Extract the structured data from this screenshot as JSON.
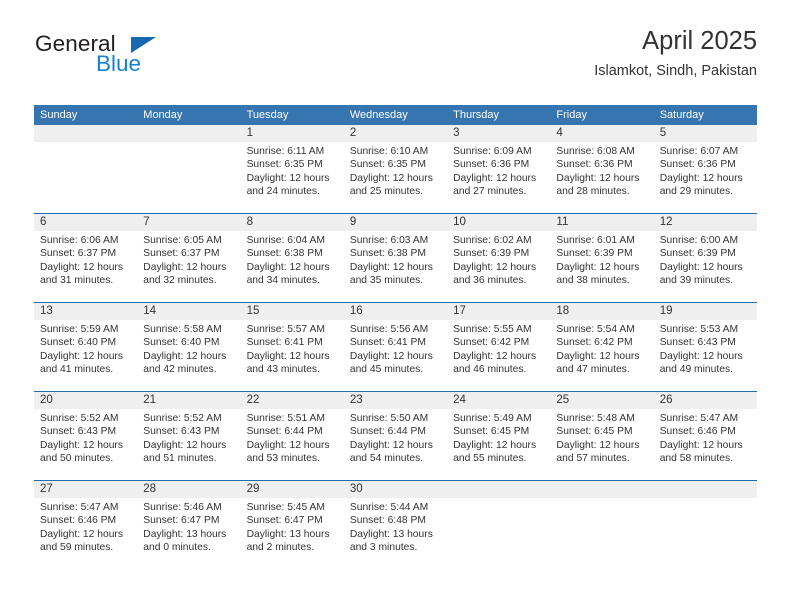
{
  "branding": {
    "logo_text_1": "General",
    "logo_text_2": "Blue",
    "logo_triangle_color": "#1669b0",
    "logo_blue_color": "#1682d4"
  },
  "header": {
    "title": "April 2025",
    "subtitle": "Islamkot, Sindh, Pakistan"
  },
  "colors": {
    "header_row_background": "#3675b0",
    "header_row_text": "#ffffff",
    "week_separator": "#1f6cb0",
    "daynum_band": "#efefef",
    "body_text": "#333333"
  },
  "weekday_headers": [
    "Sunday",
    "Monday",
    "Tuesday",
    "Wednesday",
    "Thursday",
    "Friday",
    "Saturday"
  ],
  "weeks": [
    [
      {
        "day": "",
        "sunrise": "",
        "sunset": "",
        "daylight": "",
        "empty": true
      },
      {
        "day": "",
        "sunrise": "",
        "sunset": "",
        "daylight": "",
        "empty": true
      },
      {
        "day": "1",
        "sunrise": "Sunrise: 6:11 AM",
        "sunset": "Sunset: 6:35 PM",
        "daylight": "Daylight: 12 hours and 24 minutes."
      },
      {
        "day": "2",
        "sunrise": "Sunrise: 6:10 AM",
        "sunset": "Sunset: 6:35 PM",
        "daylight": "Daylight: 12 hours and 25 minutes."
      },
      {
        "day": "3",
        "sunrise": "Sunrise: 6:09 AM",
        "sunset": "Sunset: 6:36 PM",
        "daylight": "Daylight: 12 hours and 27 minutes."
      },
      {
        "day": "4",
        "sunrise": "Sunrise: 6:08 AM",
        "sunset": "Sunset: 6:36 PM",
        "daylight": "Daylight: 12 hours and 28 minutes."
      },
      {
        "day": "5",
        "sunrise": "Sunrise: 6:07 AM",
        "sunset": "Sunset: 6:36 PM",
        "daylight": "Daylight: 12 hours and 29 minutes."
      }
    ],
    [
      {
        "day": "6",
        "sunrise": "Sunrise: 6:06 AM",
        "sunset": "Sunset: 6:37 PM",
        "daylight": "Daylight: 12 hours and 31 minutes."
      },
      {
        "day": "7",
        "sunrise": "Sunrise: 6:05 AM",
        "sunset": "Sunset: 6:37 PM",
        "daylight": "Daylight: 12 hours and 32 minutes."
      },
      {
        "day": "8",
        "sunrise": "Sunrise: 6:04 AM",
        "sunset": "Sunset: 6:38 PM",
        "daylight": "Daylight: 12 hours and 34 minutes."
      },
      {
        "day": "9",
        "sunrise": "Sunrise: 6:03 AM",
        "sunset": "Sunset: 6:38 PM",
        "daylight": "Daylight: 12 hours and 35 minutes."
      },
      {
        "day": "10",
        "sunrise": "Sunrise: 6:02 AM",
        "sunset": "Sunset: 6:39 PM",
        "daylight": "Daylight: 12 hours and 36 minutes."
      },
      {
        "day": "11",
        "sunrise": "Sunrise: 6:01 AM",
        "sunset": "Sunset: 6:39 PM",
        "daylight": "Daylight: 12 hours and 38 minutes."
      },
      {
        "day": "12",
        "sunrise": "Sunrise: 6:00 AM",
        "sunset": "Sunset: 6:39 PM",
        "daylight": "Daylight: 12 hours and 39 minutes."
      }
    ],
    [
      {
        "day": "13",
        "sunrise": "Sunrise: 5:59 AM",
        "sunset": "Sunset: 6:40 PM",
        "daylight": "Daylight: 12 hours and 41 minutes."
      },
      {
        "day": "14",
        "sunrise": "Sunrise: 5:58 AM",
        "sunset": "Sunset: 6:40 PM",
        "daylight": "Daylight: 12 hours and 42 minutes."
      },
      {
        "day": "15",
        "sunrise": "Sunrise: 5:57 AM",
        "sunset": "Sunset: 6:41 PM",
        "daylight": "Daylight: 12 hours and 43 minutes."
      },
      {
        "day": "16",
        "sunrise": "Sunrise: 5:56 AM",
        "sunset": "Sunset: 6:41 PM",
        "daylight": "Daylight: 12 hours and 45 minutes."
      },
      {
        "day": "17",
        "sunrise": "Sunrise: 5:55 AM",
        "sunset": "Sunset: 6:42 PM",
        "daylight": "Daylight: 12 hours and 46 minutes."
      },
      {
        "day": "18",
        "sunrise": "Sunrise: 5:54 AM",
        "sunset": "Sunset: 6:42 PM",
        "daylight": "Daylight: 12 hours and 47 minutes."
      },
      {
        "day": "19",
        "sunrise": "Sunrise: 5:53 AM",
        "sunset": "Sunset: 6:43 PM",
        "daylight": "Daylight: 12 hours and 49 minutes."
      }
    ],
    [
      {
        "day": "20",
        "sunrise": "Sunrise: 5:52 AM",
        "sunset": "Sunset: 6:43 PM",
        "daylight": "Daylight: 12 hours and 50 minutes."
      },
      {
        "day": "21",
        "sunrise": "Sunrise: 5:52 AM",
        "sunset": "Sunset: 6:43 PM",
        "daylight": "Daylight: 12 hours and 51 minutes."
      },
      {
        "day": "22",
        "sunrise": "Sunrise: 5:51 AM",
        "sunset": "Sunset: 6:44 PM",
        "daylight": "Daylight: 12 hours and 53 minutes."
      },
      {
        "day": "23",
        "sunrise": "Sunrise: 5:50 AM",
        "sunset": "Sunset: 6:44 PM",
        "daylight": "Daylight: 12 hours and 54 minutes."
      },
      {
        "day": "24",
        "sunrise": "Sunrise: 5:49 AM",
        "sunset": "Sunset: 6:45 PM",
        "daylight": "Daylight: 12 hours and 55 minutes."
      },
      {
        "day": "25",
        "sunrise": "Sunrise: 5:48 AM",
        "sunset": "Sunset: 6:45 PM",
        "daylight": "Daylight: 12 hours and 57 minutes."
      },
      {
        "day": "26",
        "sunrise": "Sunrise: 5:47 AM",
        "sunset": "Sunset: 6:46 PM",
        "daylight": "Daylight: 12 hours and 58 minutes."
      }
    ],
    [
      {
        "day": "27",
        "sunrise": "Sunrise: 5:47 AM",
        "sunset": "Sunset: 6:46 PM",
        "daylight": "Daylight: 12 hours and 59 minutes."
      },
      {
        "day": "28",
        "sunrise": "Sunrise: 5:46 AM",
        "sunset": "Sunset: 6:47 PM",
        "daylight": "Daylight: 13 hours and 0 minutes."
      },
      {
        "day": "29",
        "sunrise": "Sunrise: 5:45 AM",
        "sunset": "Sunset: 6:47 PM",
        "daylight": "Daylight: 13 hours and 2 minutes."
      },
      {
        "day": "30",
        "sunrise": "Sunrise: 5:44 AM",
        "sunset": "Sunset: 6:48 PM",
        "daylight": "Daylight: 13 hours and 3 minutes."
      },
      {
        "day": "",
        "sunrise": "",
        "sunset": "",
        "daylight": "",
        "empty": true
      },
      {
        "day": "",
        "sunrise": "",
        "sunset": "",
        "daylight": "",
        "empty": true
      },
      {
        "day": "",
        "sunrise": "",
        "sunset": "",
        "daylight": "",
        "empty": true
      }
    ]
  ]
}
